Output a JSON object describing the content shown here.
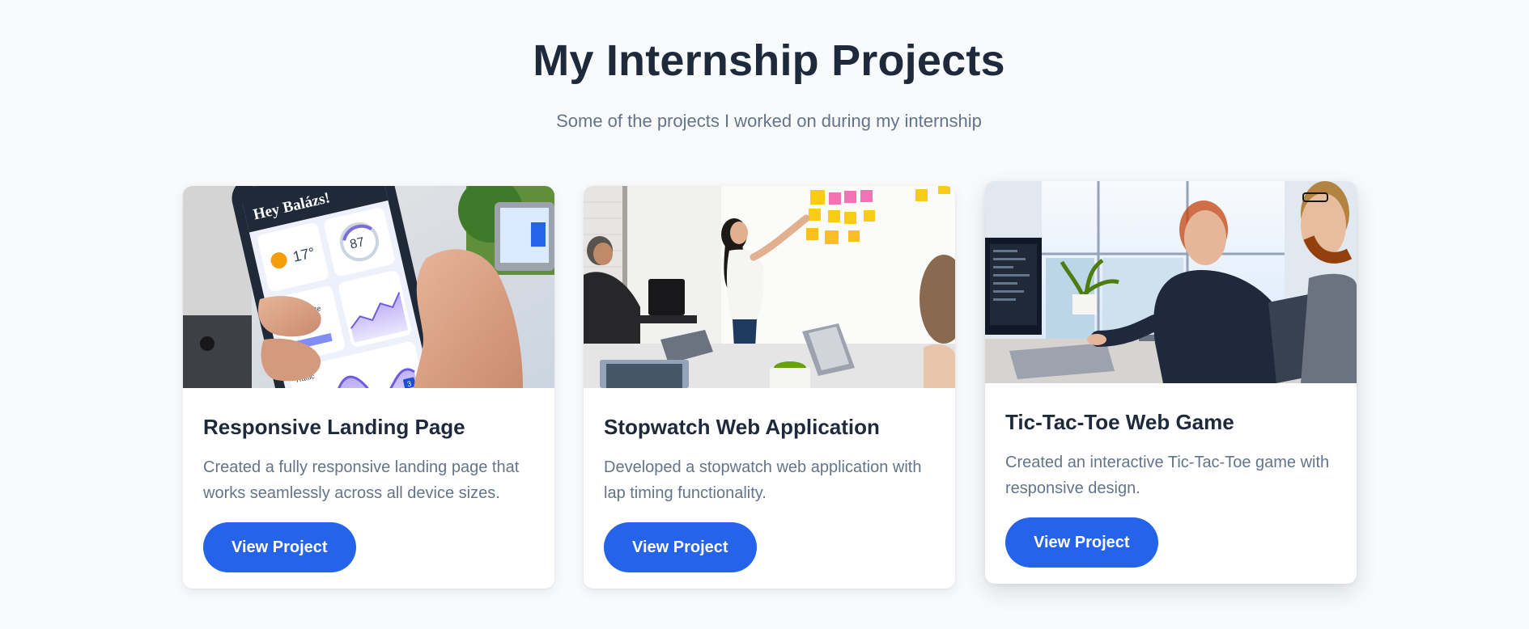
{
  "header": {
    "title": "My Internship Projects",
    "subtitle": "Some of the projects I worked on during my internship"
  },
  "projects": [
    {
      "title": "Responsive Landing Page",
      "description": "Created a fully responsive landing page that works seamlessly across all device sizes.",
      "button_label": "View Project",
      "image_text": {
        "greeting": "Hey Balázs!",
        "temperature": "17°",
        "air_quality": "87",
        "state": "Natural state",
        "traffic": "Traffic",
        "badge": "3"
      }
    },
    {
      "title": "Stopwatch Web Application",
      "description": "Developed a stopwatch web application with lap timing functionality.",
      "button_label": "View Project"
    },
    {
      "title": "Tic-Tac-Toe Web Game",
      "description": "Created an interactive Tic-Tac-Toe game with responsive design.",
      "button_label": "View Project"
    }
  ],
  "colors": {
    "background": "#f8fafc",
    "heading": "#1e293b",
    "muted": "#64748b",
    "accent": "#2563eb"
  }
}
